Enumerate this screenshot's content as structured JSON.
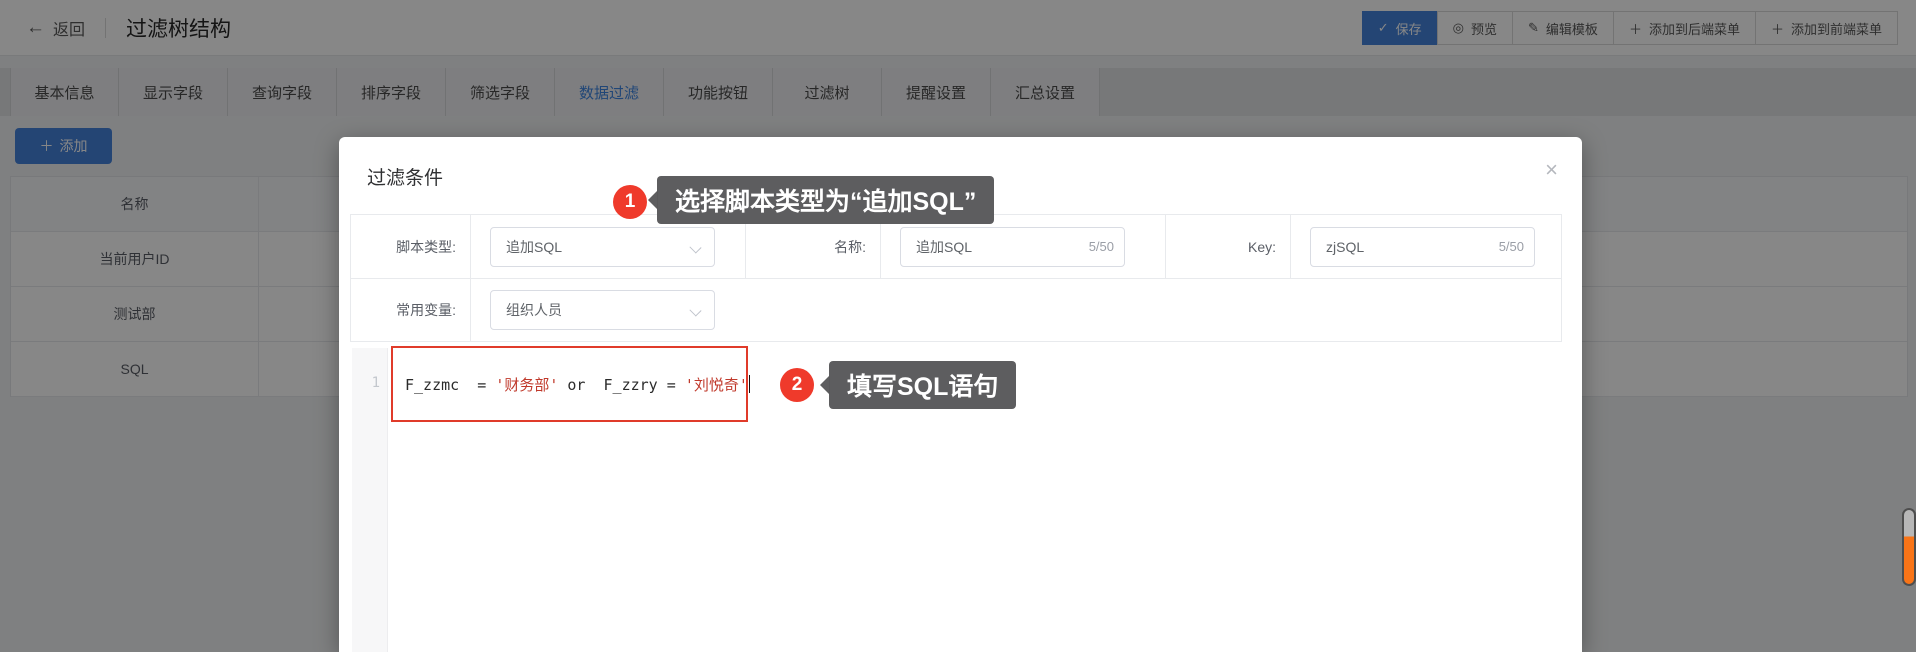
{
  "topbar": {
    "back_label": "返回",
    "back_icon": "←",
    "title": "过滤树结构",
    "buttons": [
      {
        "name": "save-button",
        "icon_name": "check-icon",
        "glyph": "✓",
        "label": "保存",
        "primary": true
      },
      {
        "name": "preview-button",
        "icon_name": "eye-icon",
        "glyph": "◎",
        "label": "预览",
        "primary": false
      },
      {
        "name": "edit-template-button",
        "icon_name": "pencil-icon",
        "glyph": "✎",
        "label": "编辑模板",
        "primary": false
      },
      {
        "name": "add-backend-menu-button",
        "icon_name": "plus-icon",
        "glyph": "＋",
        "label": "添加到后端菜单",
        "primary": false
      },
      {
        "name": "add-frontend-menu-button",
        "icon_name": "plus-icon",
        "glyph": "＋",
        "label": "添加到前端菜单",
        "primary": false
      }
    ]
  },
  "tabs": {
    "active_index": 5,
    "items": [
      "基本信息",
      "显示字段",
      "查询字段",
      "排序字段",
      "筛选字段",
      "数据过滤",
      "功能按钮",
      "过滤树",
      "提醒设置",
      "汇总设置"
    ]
  },
  "toolbar": {
    "add_label": "添加",
    "add_icon": "＋"
  },
  "bg_table": {
    "rows": [
      "名称",
      "当前用户ID",
      "测试部",
      "SQL"
    ],
    "header_index": 0
  },
  "modal": {
    "title": "过滤条件",
    "close_glyph": "×",
    "form": {
      "script_type": {
        "label": "脚本类型:",
        "value": "追加SQL"
      },
      "name": {
        "label": "名称:",
        "value": "追加SQL",
        "counter": "5/50"
      },
      "key": {
        "label": "Key:",
        "value": "zjSQL",
        "counter": "5/50"
      },
      "common_var": {
        "label": "常用变量:",
        "value": "组织人员"
      }
    },
    "editor": {
      "line_number": "1",
      "code_segments": [
        {
          "text": "F_zzmc  = ",
          "type": "plain"
        },
        {
          "text": "'财务部'",
          "type": "string"
        },
        {
          "text": " or  ",
          "type": "plain"
        },
        {
          "text": "F_zzry = ",
          "type": "plain"
        },
        {
          "text": "'刘悦奇'",
          "type": "string"
        }
      ]
    }
  },
  "annotations": {
    "step1": {
      "badge": "1",
      "text": "选择脚本类型为“追加SQL”"
    },
    "step2": {
      "badge": "2",
      "text": "填写SQL语句"
    }
  },
  "colors": {
    "accent_blue": "#4583dc",
    "active_tab_blue": "#3d84e0",
    "badge_red": "#ef3a2b",
    "highlight_border_red": "#e03b2a",
    "sql_string_red": "#c0392b",
    "tooltip_gray": "#58585a",
    "scroll_pill_orange": "#f97417"
  }
}
